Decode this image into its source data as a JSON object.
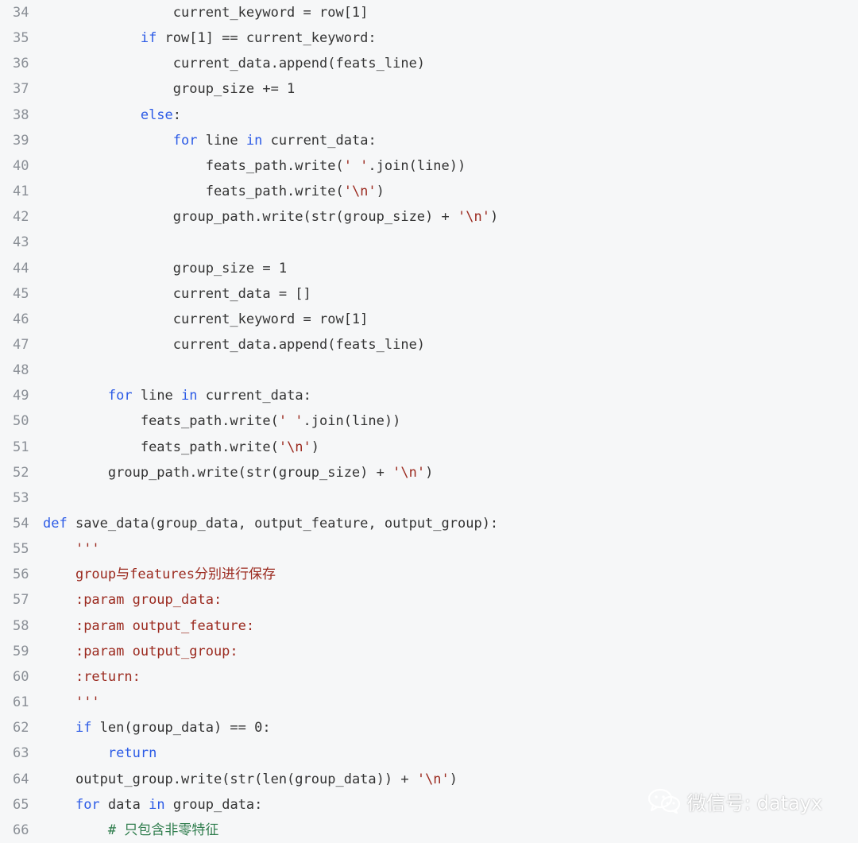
{
  "lines": [
    {
      "n": "34",
      "indent": "                ",
      "tokens": [
        {
          "t": "current_keyword = row[1]",
          "c": "plain"
        }
      ]
    },
    {
      "n": "35",
      "indent": "            ",
      "tokens": [
        {
          "t": "if",
          "c": "kw"
        },
        {
          "t": " row[1] == current_keyword:",
          "c": "plain"
        }
      ]
    },
    {
      "n": "36",
      "indent": "                ",
      "tokens": [
        {
          "t": "current_data.append(feats_line)",
          "c": "plain"
        }
      ]
    },
    {
      "n": "37",
      "indent": "                ",
      "tokens": [
        {
          "t": "group_size += 1",
          "c": "plain"
        }
      ]
    },
    {
      "n": "38",
      "indent": "            ",
      "tokens": [
        {
          "t": "else",
          "c": "kw"
        },
        {
          "t": ":",
          "c": "plain"
        }
      ]
    },
    {
      "n": "39",
      "indent": "                ",
      "tokens": [
        {
          "t": "for",
          "c": "kw"
        },
        {
          "t": " line ",
          "c": "plain"
        },
        {
          "t": "in",
          "c": "kw"
        },
        {
          "t": " current_data:",
          "c": "plain"
        }
      ]
    },
    {
      "n": "40",
      "indent": "                    ",
      "tokens": [
        {
          "t": "feats_path.write(",
          "c": "plain"
        },
        {
          "t": "' '",
          "c": "str"
        },
        {
          "t": ".join(line))",
          "c": "plain"
        }
      ]
    },
    {
      "n": "41",
      "indent": "                    ",
      "tokens": [
        {
          "t": "feats_path.write(",
          "c": "plain"
        },
        {
          "t": "'\\n'",
          "c": "str"
        },
        {
          "t": ")",
          "c": "plain"
        }
      ]
    },
    {
      "n": "42",
      "indent": "                ",
      "tokens": [
        {
          "t": "group_path.write(str(group_size) + ",
          "c": "plain"
        },
        {
          "t": "'\\n'",
          "c": "str"
        },
        {
          "t": ")",
          "c": "plain"
        }
      ]
    },
    {
      "n": "43",
      "indent": "",
      "tokens": []
    },
    {
      "n": "44",
      "indent": "                ",
      "tokens": [
        {
          "t": "group_size = 1",
          "c": "plain"
        }
      ]
    },
    {
      "n": "45",
      "indent": "                ",
      "tokens": [
        {
          "t": "current_data = []",
          "c": "plain"
        }
      ]
    },
    {
      "n": "46",
      "indent": "                ",
      "tokens": [
        {
          "t": "current_keyword = row[1]",
          "c": "plain"
        }
      ]
    },
    {
      "n": "47",
      "indent": "                ",
      "tokens": [
        {
          "t": "current_data.append(feats_line)",
          "c": "plain"
        }
      ]
    },
    {
      "n": "48",
      "indent": "",
      "tokens": []
    },
    {
      "n": "49",
      "indent": "        ",
      "tokens": [
        {
          "t": "for",
          "c": "kw"
        },
        {
          "t": " line ",
          "c": "plain"
        },
        {
          "t": "in",
          "c": "kw"
        },
        {
          "t": " current_data:",
          "c": "plain"
        }
      ]
    },
    {
      "n": "50",
      "indent": "            ",
      "tokens": [
        {
          "t": "feats_path.write(",
          "c": "plain"
        },
        {
          "t": "' '",
          "c": "str"
        },
        {
          "t": ".join(line))",
          "c": "plain"
        }
      ]
    },
    {
      "n": "51",
      "indent": "            ",
      "tokens": [
        {
          "t": "feats_path.write(",
          "c": "plain"
        },
        {
          "t": "'\\n'",
          "c": "str"
        },
        {
          "t": ")",
          "c": "plain"
        }
      ]
    },
    {
      "n": "52",
      "indent": "        ",
      "tokens": [
        {
          "t": "group_path.write(str(group_size) + ",
          "c": "plain"
        },
        {
          "t": "'\\n'",
          "c": "str"
        },
        {
          "t": ")",
          "c": "plain"
        }
      ]
    },
    {
      "n": "53",
      "indent": "",
      "tokens": []
    },
    {
      "n": "54",
      "indent": "",
      "tokens": [
        {
          "t": "def",
          "c": "kw"
        },
        {
          "t": " save_data(group_data, output_feature, output_group):",
          "c": "plain"
        }
      ]
    },
    {
      "n": "55",
      "indent": "    ",
      "tokens": [
        {
          "t": "'''",
          "c": "str"
        }
      ]
    },
    {
      "n": "56",
      "indent": "    ",
      "tokens": [
        {
          "t": "group与features分别进行保存",
          "c": "str"
        }
      ]
    },
    {
      "n": "57",
      "indent": "    ",
      "tokens": [
        {
          "t": ":param group_data:",
          "c": "str"
        }
      ]
    },
    {
      "n": "58",
      "indent": "    ",
      "tokens": [
        {
          "t": ":param output_feature:",
          "c": "str"
        }
      ]
    },
    {
      "n": "59",
      "indent": "    ",
      "tokens": [
        {
          "t": ":param output_group:",
          "c": "str"
        }
      ]
    },
    {
      "n": "60",
      "indent": "    ",
      "tokens": [
        {
          "t": ":return:",
          "c": "str"
        }
      ]
    },
    {
      "n": "61",
      "indent": "    ",
      "tokens": [
        {
          "t": "'''",
          "c": "str"
        }
      ]
    },
    {
      "n": "62",
      "indent": "    ",
      "tokens": [
        {
          "t": "if",
          "c": "kw"
        },
        {
          "t": " len(group_data) == 0:",
          "c": "plain"
        }
      ]
    },
    {
      "n": "63",
      "indent": "        ",
      "tokens": [
        {
          "t": "return",
          "c": "kw"
        }
      ]
    },
    {
      "n": "64",
      "indent": "    ",
      "tokens": [
        {
          "t": "output_group.write(str(len(group_data)) + ",
          "c": "plain"
        },
        {
          "t": "'\\n'",
          "c": "str"
        },
        {
          "t": ")",
          "c": "plain"
        }
      ]
    },
    {
      "n": "65",
      "indent": "    ",
      "tokens": [
        {
          "t": "for",
          "c": "kw"
        },
        {
          "t": " data ",
          "c": "plain"
        },
        {
          "t": "in",
          "c": "kw"
        },
        {
          "t": " group_data:",
          "c": "plain"
        }
      ]
    },
    {
      "n": "66",
      "indent": "        ",
      "tokens": [
        {
          "t": "# 只包含非零特征",
          "c": "com"
        }
      ]
    }
  ],
  "watermark": {
    "icon": "wechat-icon",
    "text": "微信号: datayx"
  },
  "colors": {
    "background": "#f6f7f8",
    "keyword": "#2c5be6",
    "string": "#9b2a1f",
    "comment": "#2f7d4d",
    "line_number": "#8a8f96"
  }
}
